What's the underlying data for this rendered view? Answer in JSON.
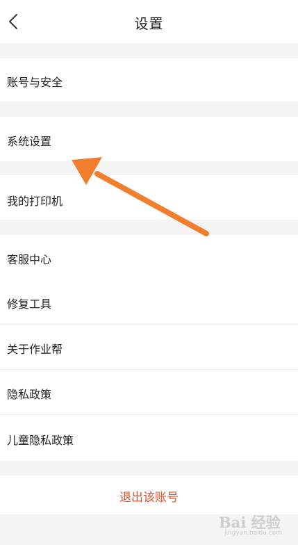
{
  "header": {
    "title": "设置",
    "back_icon": "chevron-left-icon"
  },
  "settings": {
    "account_security": "账号与安全",
    "system_settings": "系统设置",
    "my_printer": "我的打印机",
    "customer_service": "客服中心",
    "repair_tool": "修复工具",
    "about": "关于作业帮",
    "privacy_policy": "隐私政策",
    "child_privacy_policy": "儿童隐私政策"
  },
  "logout": {
    "label": "退出该账号"
  },
  "annotation": {
    "color": "#f07e2d",
    "icon": "pointer-arrow-icon"
  },
  "watermark": {
    "brand": "Bai 经验",
    "url": "jingyan.baidu.com"
  },
  "colors": {
    "background": "#f4f4f4",
    "row": "#ffffff",
    "logout_text": "#e0522b"
  }
}
